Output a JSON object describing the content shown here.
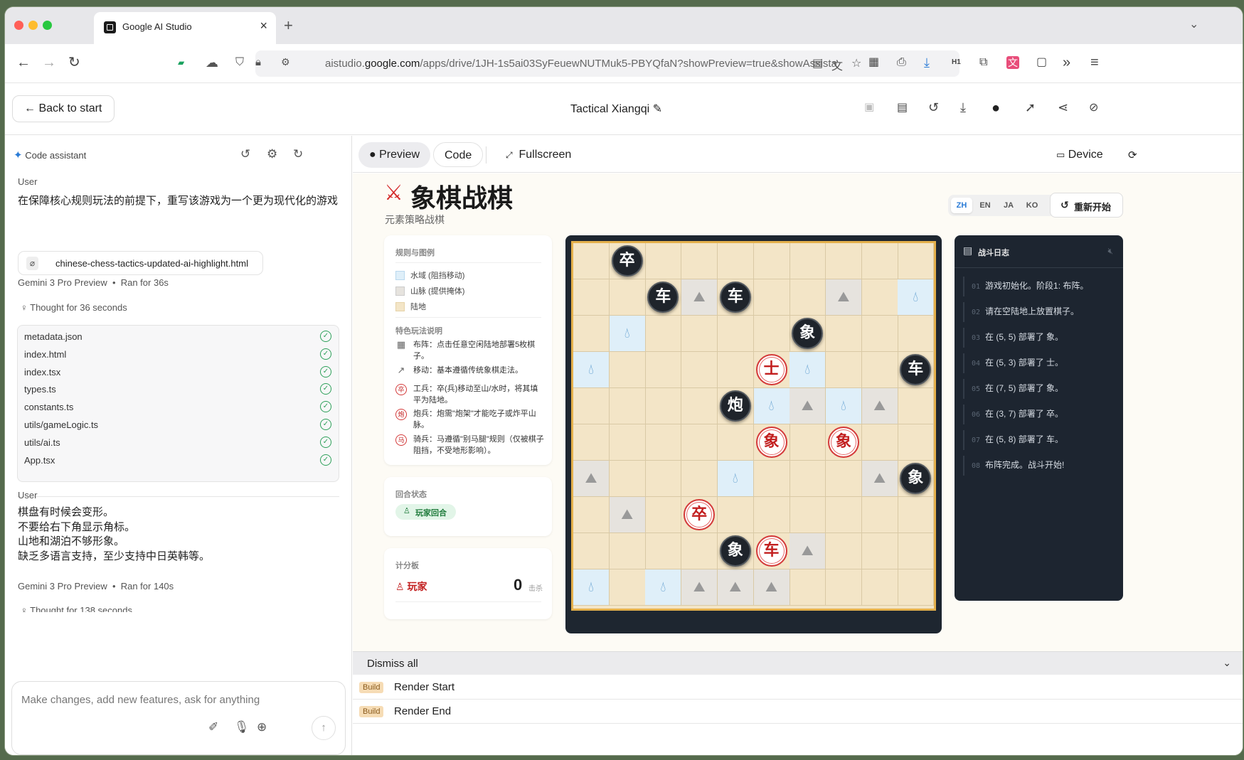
{
  "browser": {
    "tab_title": "Google AI Studio",
    "url_prefix": "aistudio.",
    "url_domain": "google.com",
    "url_path": "/apps/drive/1JH-1s5ai03SyFeuewNUTMuk5-PBYQfaN?showPreview=true&showAssista"
  },
  "app": {
    "back_label": "Back to start",
    "title": "Tactical Xiangqi"
  },
  "left": {
    "panel_title": "Code assistant",
    "msg1_role": "User",
    "msg1_text": "在保障核心规则玩法的前提下，重写该游戏为一个更为现代化的游戏",
    "attachment": "chinese-chess-tactics-updated-ai-highlight.html",
    "model1": "Gemini 3 Pro Preview",
    "ran1": "Ran for 36s",
    "thought1": "Thought for 36 seconds",
    "files": [
      "metadata.json",
      "index.html",
      "index.tsx",
      "types.ts",
      "constants.ts",
      "utils/gameLogic.ts",
      "utils/ai.ts",
      "App.tsx"
    ],
    "msg2_role": "User",
    "msg2_lines": [
      "棋盘有时候会变形。",
      "不要给右下角显示角标。",
      "山地和湖泊不够形象。",
      "缺乏多语言支持，至少支持中日英韩等。"
    ],
    "model2": "Gemini 3 Pro Preview",
    "ran2": "Ran for 140s",
    "thought2": "Thought for 138 seconds",
    "input_placeholder": "Make changes, add new features, ask for anything"
  },
  "right": {
    "tab_preview": "Preview",
    "tab_code": "Code",
    "tab_fullscreen": "Fullscreen",
    "device": "Device"
  },
  "game": {
    "title": "象棋战棋",
    "subtitle": "元素策略战棋",
    "langs": [
      "ZH",
      "EN",
      "JA",
      "KO"
    ],
    "restart": "重新开始",
    "legend_title": "规则与图例",
    "legend": [
      "水域 (阻挡移动)",
      "山脉 (提供掩体)",
      "陆地"
    ],
    "features_title": "特色玩法说明",
    "features": [
      {
        "icon": "▦",
        "text": "布阵：点击任意空闲陆地部署5枚棋子。"
      },
      {
        "icon": "↗",
        "text": "移动：基本遵循传统象棋走法。"
      },
      {
        "icon": "卒",
        "text": "工兵：卒(兵)移动至山/水时，将其填平为陆地。"
      },
      {
        "icon": "炮",
        "text": "炮兵：炮需\"炮架\"才能吃子或炸平山脉。"
      },
      {
        "icon": "马",
        "text": "骑兵：马遵循\"别马腿\"规则（仅被棋子阻挡，不受地形影响）。"
      }
    ],
    "turn_title": "回合状态",
    "turn_badge": "玩家回合",
    "score_title": "计分板",
    "score_player": "玩家",
    "score_value": "0",
    "score_unit": "击杀",
    "log_title": "战斗日志",
    "log": [
      "游戏初始化。阶段1: 布阵。",
      "请在空陆地上放置棋子。",
      "在 (5, 5) 部署了 象。",
      "在 (5, 3) 部署了 士。",
      "在 (7, 5) 部署了 象。",
      "在 (3, 7) 部署了 卒。",
      "在 (5, 8) 部署了 车。",
      "布阵完成。战斗开始!"
    ],
    "board": {
      "cols": 10,
      "rows": 10,
      "water": [
        [
          9,
          1
        ],
        [
          1,
          2
        ],
        [
          0,
          3
        ],
        [
          6,
          3
        ],
        [
          5,
          4
        ],
        [
          7,
          4
        ],
        [
          4,
          6
        ],
        [
          0,
          9
        ],
        [
          2,
          9
        ]
      ],
      "mountain": [
        [
          3,
          1
        ],
        [
          7,
          1
        ],
        [
          6,
          4
        ],
        [
          8,
          4
        ],
        [
          0,
          6
        ],
        [
          8,
          6
        ],
        [
          1,
          7
        ],
        [
          6,
          8
        ],
        [
          3,
          9
        ],
        [
          4,
          9
        ],
        [
          5,
          9
        ]
      ],
      "pieces": [
        {
          "c": 1,
          "r": 0,
          "t": "卒",
          "side": "black"
        },
        {
          "c": 2,
          "r": 1,
          "t": "车",
          "side": "black"
        },
        {
          "c": 4,
          "r": 1,
          "t": "车",
          "side": "black"
        },
        {
          "c": 6,
          "r": 2,
          "t": "象",
          "side": "black"
        },
        {
          "c": 5,
          "r": 3,
          "t": "士",
          "side": "red"
        },
        {
          "c": 9,
          "r": 3,
          "t": "车",
          "side": "black"
        },
        {
          "c": 4,
          "r": 4,
          "t": "炮",
          "side": "black"
        },
        {
          "c": 5,
          "r": 5,
          "t": "象",
          "side": "red"
        },
        {
          "c": 7,
          "r": 5,
          "t": "象",
          "side": "red"
        },
        {
          "c": 9,
          "r": 6,
          "t": "象",
          "side": "black"
        },
        {
          "c": 3,
          "r": 7,
          "t": "卒",
          "side": "red"
        },
        {
          "c": 4,
          "r": 8,
          "t": "象",
          "side": "black"
        },
        {
          "c": 5,
          "r": 8,
          "t": "车",
          "side": "red"
        }
      ]
    }
  },
  "console": {
    "dismiss": "Dismiss all",
    "rows": [
      {
        "tag": "Build",
        "text": "Render Start"
      },
      {
        "tag": "Build",
        "text": "Render End"
      }
    ]
  }
}
